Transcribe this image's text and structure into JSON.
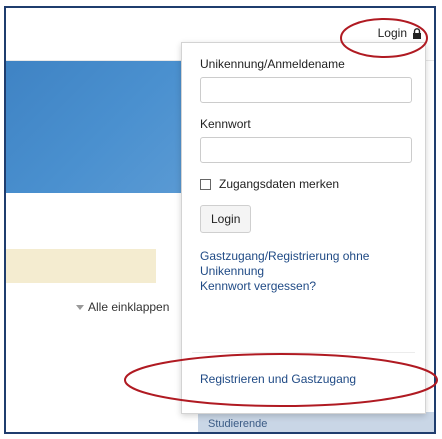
{
  "header": {
    "login_label": "Login",
    "lock_icon": "lock-icon"
  },
  "main": {
    "collapse_all_label": "Alle einklappen",
    "collapse_icon": "triangle-down-icon",
    "sidebar_item_label": "Studierende"
  },
  "login_form": {
    "username_label": "Unikennung/Anmeldename",
    "username_value": "",
    "password_label": "Kennwort",
    "password_value": "",
    "remember_label": "Zugangsdaten merken",
    "remember_checked": false,
    "submit_label": "Login",
    "guest_link": "Gastzugang/Registrierung ohne Unikennung",
    "forgot_link": "Kennwort vergessen?",
    "register_link": "Registrieren und Gastzugang"
  },
  "colors": {
    "accent": "#1f4a85",
    "annotation": "#b01a22",
    "banner": "#4a90cf"
  }
}
